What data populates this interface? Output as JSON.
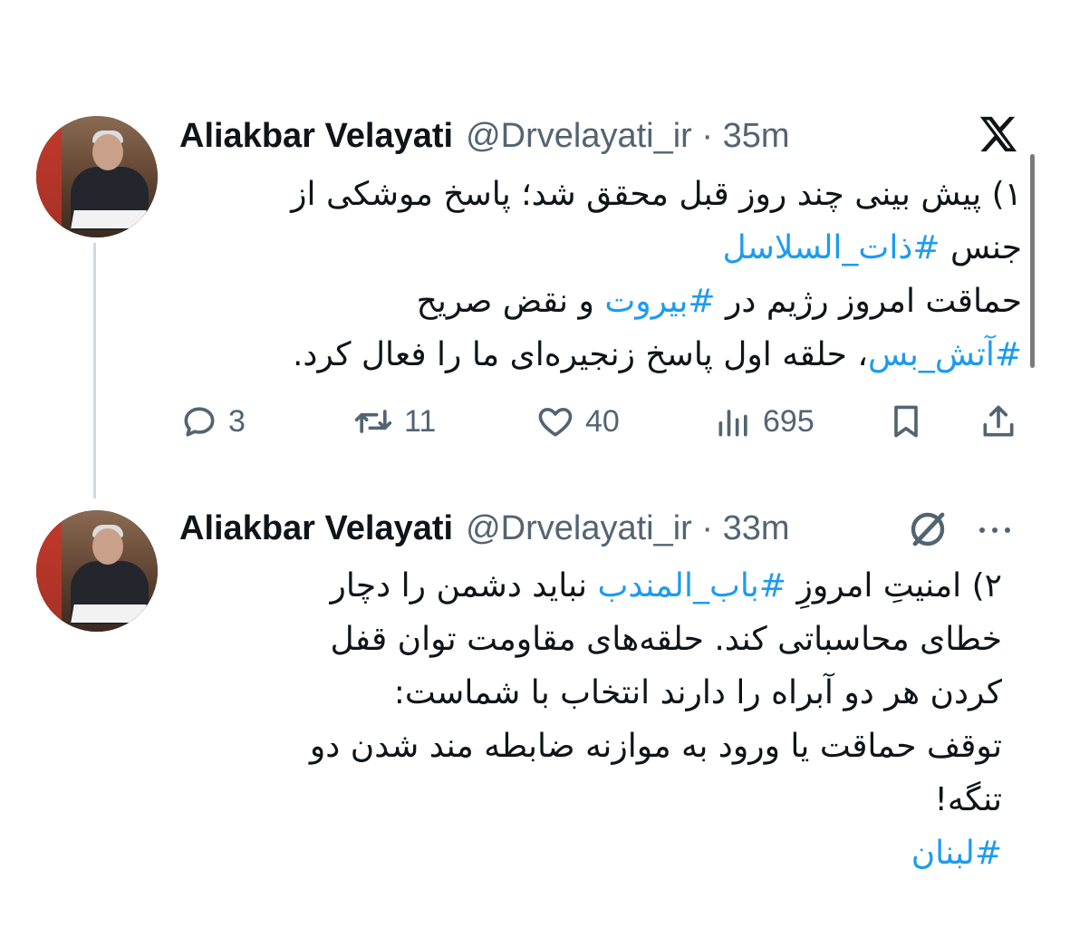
{
  "tweets": [
    {
      "author_name": "Aliakbar Velayati",
      "handle_time": "@Drvelayati_ir · 35m",
      "body_lines": [
        [
          {
            "t": "۱) پیش بینی چند روز قبل محقق شد؛ پاسخ موشکی از",
            "tag": false
          }
        ],
        [
          {
            "t": "جنس ",
            "tag": false
          },
          {
            "t": "#ذات_السلاسل",
            "tag": true
          }
        ],
        [
          {
            "t": "حماقت امروز رژیم در ",
            "tag": false
          },
          {
            "t": "#بیروت",
            "tag": true
          },
          {
            "t": " و نقض صریح",
            "tag": false
          }
        ],
        [
          {
            "t": "#آتش_بس",
            "tag": true
          },
          {
            "t": "، حلقه اول پاسخ زنجیره‌ای ما را فعال کرد.",
            "tag": false
          }
        ]
      ],
      "stats": {
        "replies": "3",
        "reposts": "11",
        "likes": "40",
        "views": "695"
      }
    },
    {
      "author_name": "Aliakbar Velayati",
      "handle_time": "@Drvelayati_ir · 33m",
      "body_lines": [
        [
          {
            "t": "۲) امنیتِ امروزِ ",
            "tag": false
          },
          {
            "t": "#باب_المندب",
            "tag": true
          },
          {
            "t": " نباید دشمن را دچار",
            "tag": false
          }
        ],
        [
          {
            "t": "خطای محاسباتی کند. حلقه‌های مقاومت توان قفل",
            "tag": false
          }
        ],
        [
          {
            "t": "کردن هر دو آبراه را دارند انتخاب با شماست:",
            "tag": false
          }
        ],
        [
          {
            "t": "توقف حماقت یا ورود به موازنه ضابطه مند شدن دو",
            "tag": false
          }
        ],
        [
          {
            "t": "تنگه!",
            "tag": false
          }
        ],
        [
          {
            "t": "#لبنان",
            "tag": true
          }
        ]
      ]
    }
  ],
  "icons": {
    "platform": "x-logo-icon",
    "reply": "comment-icon",
    "repost": "repost-icon",
    "like": "heart-icon",
    "views": "views-icon",
    "bookmark": "bookmark-icon",
    "share": "share-icon",
    "grok": "grok-icon",
    "more": "more-icon"
  },
  "colors": {
    "hashtag": "#1d9bf0",
    "secondary_text": "#536471",
    "primary_text": "#0f1419"
  }
}
